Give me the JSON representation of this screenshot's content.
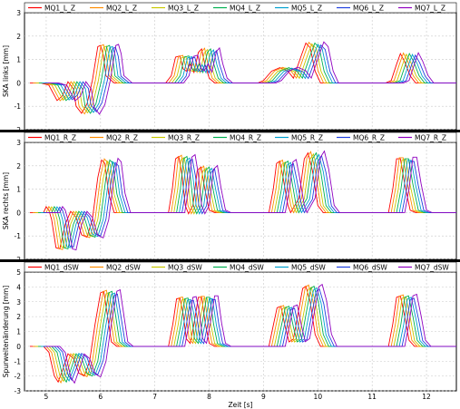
{
  "chart_data": {
    "type": "line",
    "x": [
      4.6,
      12.55
    ],
    "xlabel": "Zeit [s]",
    "xticks": [
      5,
      6,
      7,
      8,
      9,
      10,
      11,
      12
    ],
    "grid": true,
    "legend_position": "top",
    "colors": [
      "#ff0000",
      "#ff8c00",
      "#c8c800",
      "#00b050",
      "#00a0d0",
      "#2040e0",
      "#9000c0"
    ],
    "panels": [
      {
        "ylabel": "SKA links [mm]",
        "ylim": [
          -2,
          3
        ],
        "yticks": [
          -2,
          -1,
          0,
          1,
          2,
          3
        ],
        "series_names": [
          "MQ1_L_Z",
          "MQ2_L_Z",
          "MQ3_L_Z",
          "MQ4_L_Z",
          "MQ5_L_Z",
          "MQ6_L_Z",
          "MQ7_L_Z"
        ],
        "base_series": [
          [
            4.7,
            0
          ],
          [
            4.9,
            0
          ],
          [
            5.05,
            -0.1
          ],
          [
            5.2,
            -0.75
          ],
          [
            5.3,
            -0.55
          ],
          [
            5.4,
            0.05
          ],
          [
            5.5,
            -0.25
          ],
          [
            5.55,
            -1.0
          ],
          [
            5.65,
            -1.3
          ],
          [
            5.75,
            -0.9
          ],
          [
            5.85,
            0.1
          ],
          [
            5.95,
            1.55
          ],
          [
            6.0,
            1.6
          ],
          [
            6.05,
            1.2
          ],
          [
            6.1,
            0.3
          ],
          [
            6.15,
            0.2
          ],
          [
            6.25,
            0
          ],
          [
            7.2,
            0
          ],
          [
            7.3,
            0.3
          ],
          [
            7.38,
            1.1
          ],
          [
            7.46,
            1.15
          ],
          [
            7.52,
            0.6
          ],
          [
            7.58,
            0.5
          ],
          [
            7.65,
            0.8
          ],
          [
            7.72,
            0.45
          ],
          [
            7.8,
            1.3
          ],
          [
            7.86,
            1.45
          ],
          [
            7.92,
            0.8
          ],
          [
            8.0,
            0.2
          ],
          [
            8.1,
            0
          ],
          [
            8.9,
            0
          ],
          [
            9.0,
            0.1
          ],
          [
            9.15,
            0.5
          ],
          [
            9.3,
            0.65
          ],
          [
            9.45,
            0.5
          ],
          [
            9.55,
            0.2
          ],
          [
            9.7,
            1.2
          ],
          [
            9.78,
            1.7
          ],
          [
            9.86,
            1.5
          ],
          [
            9.95,
            0.5
          ],
          [
            10.05,
            0
          ],
          [
            11.25,
            0
          ],
          [
            11.35,
            0.1
          ],
          [
            11.45,
            0.8
          ],
          [
            11.52,
            1.25
          ],
          [
            11.6,
            0.9
          ],
          [
            11.7,
            0.3
          ],
          [
            11.8,
            0
          ],
          [
            12.55,
            0
          ]
        ],
        "offsets": [
          0,
          0.055,
          0.11,
          0.165,
          0.22,
          0.275,
          0.33
        ],
        "scales": [
          1,
          1.02,
          0.98,
          1.0,
          0.97,
          0.95,
          1.03
        ]
      },
      {
        "ylabel": "SKA rechts [mm]",
        "ylim": [
          -2,
          3
        ],
        "yticks": [
          -2,
          -1,
          0,
          1,
          2,
          3
        ],
        "series_names": [
          "MQ1_R_Z",
          "MQ2_R_Z",
          "MQ3_R_Z",
          "MQ4_R_Z",
          "MQ5_R_Z",
          "MQ6_R_Z",
          "MQ7_R_Z"
        ],
        "base_series": [
          [
            4.7,
            0
          ],
          [
            4.95,
            0
          ],
          [
            5.0,
            0.25
          ],
          [
            5.05,
            0.1
          ],
          [
            5.1,
            -0.3
          ],
          [
            5.18,
            -1.5
          ],
          [
            5.25,
            -1.55
          ],
          [
            5.35,
            -0.5
          ],
          [
            5.45,
            0.05
          ],
          [
            5.55,
            -0.2
          ],
          [
            5.65,
            -0.95
          ],
          [
            5.75,
            -1.05
          ],
          [
            5.85,
            -0.3
          ],
          [
            5.95,
            1.5
          ],
          [
            6.02,
            2.25
          ],
          [
            6.08,
            2.1
          ],
          [
            6.15,
            0.8
          ],
          [
            6.25,
            0
          ],
          [
            7.25,
            0
          ],
          [
            7.32,
            1.0
          ],
          [
            7.38,
            2.3
          ],
          [
            7.44,
            2.4
          ],
          [
            7.5,
            1.6
          ],
          [
            7.56,
            0.3
          ],
          [
            7.62,
            -0.05
          ],
          [
            7.7,
            0.3
          ],
          [
            7.78,
            1.8
          ],
          [
            7.85,
            1.95
          ],
          [
            7.92,
            1.0
          ],
          [
            8.0,
            0.1
          ],
          [
            8.1,
            0
          ],
          [
            9.1,
            0
          ],
          [
            9.18,
            1.0
          ],
          [
            9.24,
            2.1
          ],
          [
            9.3,
            2.2
          ],
          [
            9.36,
            1.5
          ],
          [
            9.45,
            0.3
          ],
          [
            9.5,
            0
          ],
          [
            9.65,
            0.6
          ],
          [
            9.75,
            2.3
          ],
          [
            9.82,
            2.55
          ],
          [
            9.9,
            1.8
          ],
          [
            10.0,
            0.3
          ],
          [
            10.1,
            0
          ],
          [
            11.3,
            0
          ],
          [
            11.38,
            1.0
          ],
          [
            11.45,
            2.3
          ],
          [
            11.52,
            2.3
          ],
          [
            11.6,
            1.2
          ],
          [
            11.7,
            0.1
          ],
          [
            11.8,
            0
          ],
          [
            12.55,
            0
          ]
        ],
        "offsets": [
          0,
          0.05,
          0.1,
          0.15,
          0.2,
          0.25,
          0.3
        ],
        "scales": [
          1,
          1.02,
          0.98,
          1.0,
          0.97,
          0.95,
          1.03
        ]
      },
      {
        "ylabel": "Spurweitenänderung [mm]",
        "ylim": [
          -3,
          5
        ],
        "yticks": [
          -3,
          -2,
          -1,
          0,
          1,
          2,
          3,
          4,
          5
        ],
        "series_names": [
          "MQ1_dSW",
          "MQ2_dSW",
          "MQ3_dSW",
          "MQ4_dSW",
          "MQ5_dSW",
          "MQ6_dSW",
          "MQ7_dSW"
        ],
        "base_series": [
          [
            4.7,
            0
          ],
          [
            4.95,
            0
          ],
          [
            5.05,
            -0.4
          ],
          [
            5.15,
            -2.0
          ],
          [
            5.22,
            -2.4
          ],
          [
            5.3,
            -1.6
          ],
          [
            5.4,
            -0.5
          ],
          [
            5.5,
            -0.8
          ],
          [
            5.6,
            -1.8
          ],
          [
            5.7,
            -2.0
          ],
          [
            5.8,
            -1.0
          ],
          [
            5.9,
            1.5
          ],
          [
            6.0,
            3.6
          ],
          [
            6.06,
            3.7
          ],
          [
            6.13,
            2.0
          ],
          [
            6.2,
            0.3
          ],
          [
            6.3,
            0
          ],
          [
            7.25,
            0
          ],
          [
            7.33,
            1.5
          ],
          [
            7.4,
            3.2
          ],
          [
            7.46,
            3.25
          ],
          [
            7.52,
            2.2
          ],
          [
            7.58,
            0.5
          ],
          [
            7.65,
            0.2
          ],
          [
            7.72,
            1.5
          ],
          [
            7.8,
            3.3
          ],
          [
            7.86,
            3.3
          ],
          [
            7.93,
            1.5
          ],
          [
            8.0,
            0.2
          ],
          [
            8.1,
            0
          ],
          [
            9.1,
            0
          ],
          [
            9.18,
            1.4
          ],
          [
            9.25,
            2.6
          ],
          [
            9.32,
            2.7
          ],
          [
            9.4,
            1.3
          ],
          [
            9.47,
            0.3
          ],
          [
            9.55,
            0.5
          ],
          [
            9.65,
            2.5
          ],
          [
            9.72,
            3.9
          ],
          [
            9.78,
            4.05
          ],
          [
            9.86,
            3.0
          ],
          [
            9.95,
            0.8
          ],
          [
            10.05,
            0
          ],
          [
            11.3,
            0
          ],
          [
            11.38,
            1.5
          ],
          [
            11.45,
            3.3
          ],
          [
            11.52,
            3.4
          ],
          [
            11.6,
            2.0
          ],
          [
            11.68,
            0.4
          ],
          [
            11.78,
            0
          ],
          [
            12.55,
            0
          ]
        ],
        "offsets": [
          0,
          0.05,
          0.1,
          0.15,
          0.2,
          0.25,
          0.3
        ],
        "scales": [
          1,
          1.02,
          0.98,
          1.0,
          0.97,
          0.95,
          1.03
        ]
      }
    ]
  }
}
